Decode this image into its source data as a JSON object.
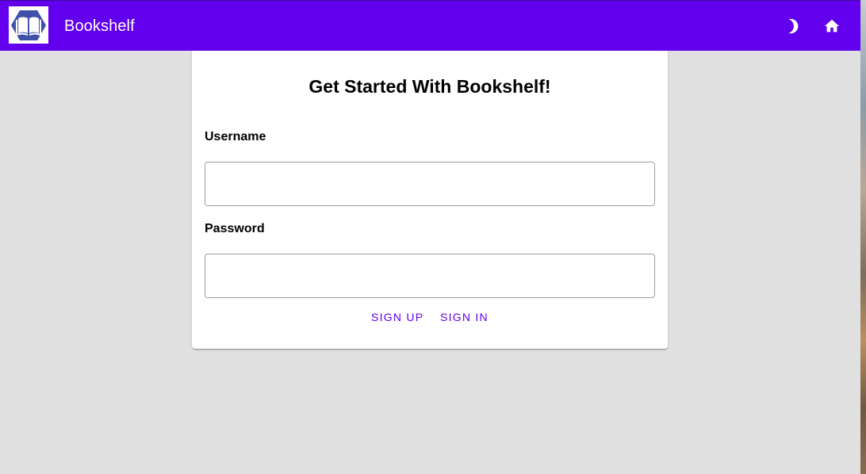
{
  "app": {
    "title": "Bookshelf",
    "logo_icon": "book-hexagon-logo",
    "brand_color": "#6200ee"
  },
  "toolbar": {
    "theme_icon": "moon-icon",
    "home_icon": "home-icon"
  },
  "card": {
    "title": "Get Started With Bookshelf!"
  },
  "form": {
    "username_label": "Username",
    "username_value": "",
    "username_placeholder": "",
    "password_label": "Password",
    "password_value": "",
    "password_placeholder": ""
  },
  "actions": {
    "sign_up_label": "SIGN UP",
    "sign_in_label": "SIGN IN"
  }
}
